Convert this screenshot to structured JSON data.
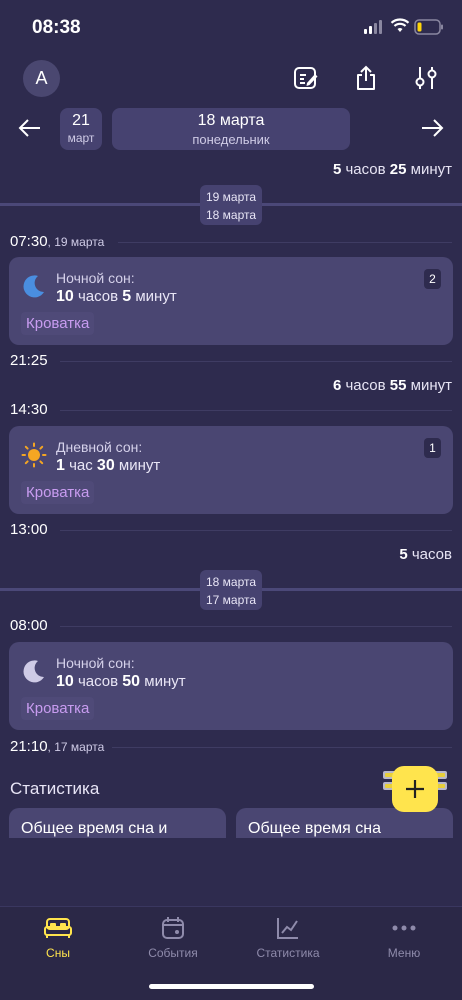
{
  "status": {
    "time": "08:38"
  },
  "header": {
    "avatar_letter": "A"
  },
  "nav": {
    "prev_day": "21",
    "prev_month": "март",
    "current_date": "18 марта",
    "current_weekday": "понедельник"
  },
  "gap_top": {
    "num1": "5",
    "unit1": "часов",
    "num2": "25",
    "unit2": "минут"
  },
  "separator1": {
    "line1": "19 марта",
    "line2": "18 марта"
  },
  "entry1": {
    "time": "07:30",
    "time_sub": ", 19 марта",
    "label": "Ночной сон:",
    "num1": "10",
    "unit1": "часов",
    "num2": "5",
    "unit2": "минут",
    "tag": "Кроватка",
    "badge": "2",
    "end_time": "21:25"
  },
  "gap_mid": {
    "num1": "6",
    "unit1": "часов",
    "num2": "55",
    "unit2": "минут"
  },
  "entry2": {
    "time": "14:30",
    "label": "Дневной сон:",
    "num1": "1",
    "unit1": "час",
    "num2": "30",
    "unit2": "минут",
    "tag": "Кроватка",
    "badge": "1",
    "end_time": "13:00"
  },
  "gap_low": {
    "num1": "5",
    "unit1": "часов"
  },
  "separator2": {
    "line1": "18 марта",
    "line2": "17 марта"
  },
  "entry3": {
    "time": "08:00",
    "label": "Ночной сон:",
    "num1": "10",
    "unit1": "часов",
    "num2": "50",
    "unit2": "минут",
    "tag": "Кроватка",
    "end_time": "21:10",
    "end_sub": ", 17 марта"
  },
  "stats": {
    "title": "Статистика",
    "card1": "Общее время сна и",
    "card2": "Общее время сна"
  },
  "tabs": [
    {
      "label": "Сны",
      "icon": "bed-icon",
      "active": true
    },
    {
      "label": "События",
      "icon": "calendar-icon",
      "active": false
    },
    {
      "label": "Статистика",
      "icon": "chart-icon",
      "active": false
    },
    {
      "label": "Меню",
      "icon": "more-icon",
      "active": false
    }
  ],
  "colors": {
    "background": "#2e2b4e",
    "card": "#4a4672",
    "accent": "#ffe44d",
    "tag_text": "#c89cf0",
    "moon_blue": "#4a8ee0",
    "sun": "#f5a623"
  }
}
